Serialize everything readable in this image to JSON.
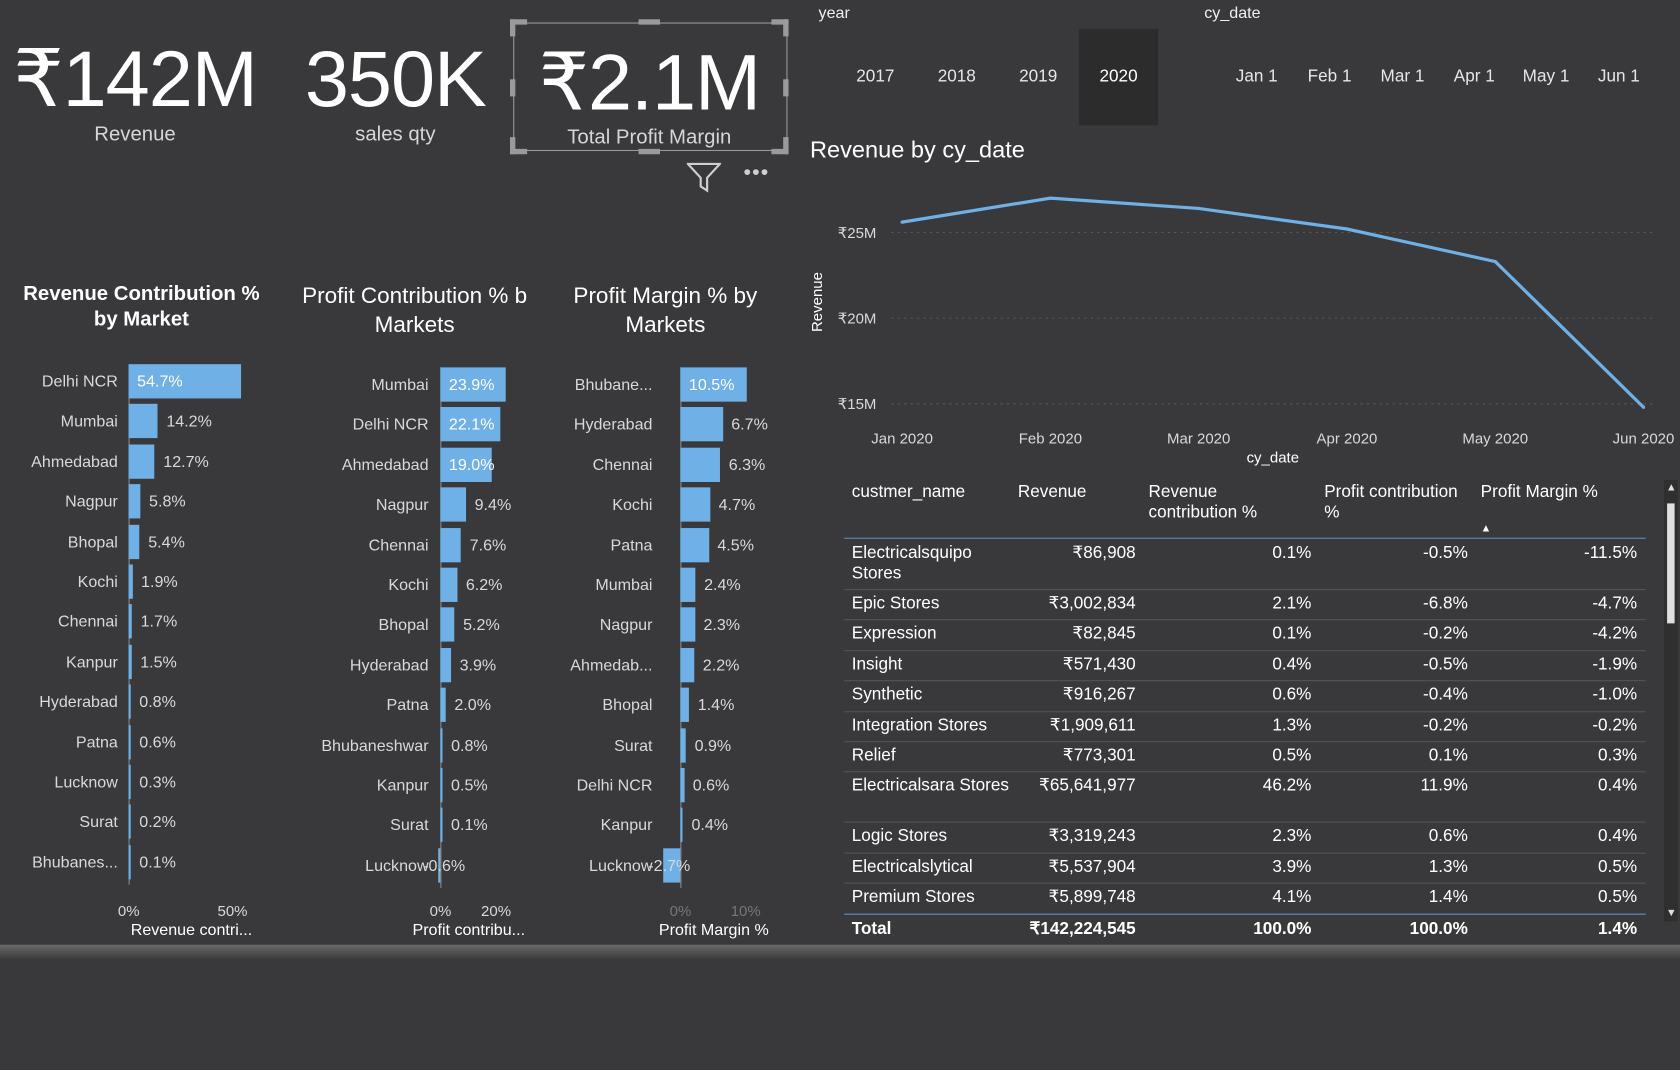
{
  "kpis": [
    {
      "value": "₹142M",
      "label": "Revenue"
    },
    {
      "value": "350K",
      "label": "sales qty"
    },
    {
      "value": "₹2.1M",
      "label": "Total Profit Margin"
    }
  ],
  "header_icons": {
    "filter": "filter-icon",
    "more": "more-options-icon",
    "more_glyph": "•••"
  },
  "year_slicer": {
    "title": "year",
    "items": [
      "2017",
      "2018",
      "2019",
      "2020"
    ],
    "selected": "2020"
  },
  "date_slicer": {
    "title": "cy_date",
    "items": [
      "Jan 1",
      "Feb 1",
      "Mar 1",
      "Apr 1",
      "May 1",
      "Jun 1"
    ]
  },
  "colors": {
    "background": "#39393b",
    "bar": "#6fb0e6",
    "line": "#6fb0e6",
    "selected_slicer": "#2c2c2c"
  },
  "revenue_contribution": {
    "title": "Revenue Contribution % by Market",
    "categories": [
      "Delhi NCR",
      "Mumbai",
      "Ahmedabad",
      "Nagpur",
      "Bhopal",
      "Kochi",
      "Chennai",
      "Kanpur",
      "Hyderabad",
      "Patna",
      "Lucknow",
      "Surat",
      "Bhubanes..."
    ],
    "values": [
      54.7,
      14.2,
      12.7,
      5.8,
      5.4,
      1.9,
      1.7,
      1.5,
      0.8,
      0.6,
      0.3,
      0.2,
      0.1
    ],
    "labels": [
      "54.7%",
      "14.2%",
      "12.7%",
      "5.8%",
      "5.4%",
      "1.9%",
      "1.7%",
      "1.5%",
      "0.8%",
      "0.6%",
      "0.3%",
      "0.2%",
      "0.1%"
    ],
    "ticks": [
      "0%",
      "50%"
    ],
    "xlabel": "Revenue contri..."
  },
  "profit_contribution": {
    "title": "Profit Contribution % b Markets",
    "categories": [
      "Mumbai",
      "Delhi NCR",
      "Ahmedabad",
      "Nagpur",
      "Chennai",
      "Kochi",
      "Bhopal",
      "Hyderabad",
      "Patna",
      "Bhubaneshwar",
      "Kanpur",
      "Surat",
      "Lucknow"
    ],
    "values": [
      23.9,
      22.1,
      19.0,
      9.4,
      7.6,
      6.2,
      5.2,
      3.9,
      2.0,
      0.8,
      0.5,
      0.1,
      -0.6
    ],
    "labels": [
      "23.9%",
      "22.1%",
      "19.0%",
      "9.4%",
      "7.6%",
      "6.2%",
      "5.2%",
      "3.9%",
      "2.0%",
      "0.8%",
      "0.5%",
      "0.1%",
      "-0.6%"
    ],
    "ticks": [
      "0%",
      "20%"
    ],
    "xlabel": "Profit contribu..."
  },
  "profit_margin": {
    "title": "Profit Margin % by Markets",
    "categories": [
      "Bhubane...",
      "Hyderabad",
      "Chennai",
      "Kochi",
      "Patna",
      "Mumbai",
      "Nagpur",
      "Ahmedab...",
      "Bhopal",
      "Surat",
      "Delhi NCR",
      "Kanpur",
      "Lucknow"
    ],
    "values": [
      10.5,
      6.7,
      6.3,
      4.7,
      4.5,
      2.4,
      2.3,
      2.2,
      1.4,
      0.9,
      0.6,
      0.4,
      -2.7
    ],
    "labels": [
      "10.5%",
      "6.7%",
      "6.3%",
      "4.7%",
      "4.5%",
      "2.4%",
      "2.3%",
      "2.2%",
      "1.4%",
      "0.9%",
      "0.6%",
      "0.4%",
      "-2.7%"
    ],
    "ticks": [
      "0%",
      "10%"
    ],
    "xlabel": "Profit Margin %"
  },
  "chart_data": {
    "type": "line",
    "title": "Revenue by cy_date",
    "x": [
      "Jan 2020",
      "Feb 2020",
      "Mar 2020",
      "Apr 2020",
      "May 2020",
      "Jun 2020"
    ],
    "y_ticks": [
      "₹25M",
      "₹20M",
      "₹15M"
    ],
    "ylim": [
      15,
      25
    ],
    "series": [
      {
        "values": [
          25.6,
          27.0,
          26.4,
          25.2,
          23.3,
          14.8
        ]
      }
    ],
    "xlabel": "cy_date",
    "ylabel": "Revenue",
    "grid": true
  },
  "table": {
    "headers": [
      "custmer_name",
      "Revenue",
      "Revenue contribution %",
      "Profit contribution %",
      "Profit Margin %"
    ],
    "sort_indicator": "▲",
    "rows": [
      [
        "Electricalsquipo Stores",
        "₹86,908",
        "0.1%",
        "-0.5%",
        "-11.5%"
      ],
      [
        "Epic Stores",
        "₹3,002,834",
        "2.1%",
        "-6.8%",
        "-4.7%"
      ],
      [
        "Expression",
        "₹82,845",
        "0.1%",
        "-0.2%",
        "-4.2%"
      ],
      [
        "Insight",
        "₹571,430",
        "0.4%",
        "-0.5%",
        "-1.9%"
      ],
      [
        "Synthetic",
        "₹916,267",
        "0.6%",
        "-0.4%",
        "-1.0%"
      ],
      [
        "Integration Stores",
        "₹1,909,611",
        "1.3%",
        "-0.2%",
        "-0.2%"
      ],
      [
        "Relief",
        "₹773,301",
        "0.5%",
        "0.1%",
        "0.3%"
      ],
      [
        "Electricalsara Stores",
        "₹65,641,977",
        "46.2%",
        "11.9%",
        "0.4%"
      ],
      [
        "Logic Stores",
        "₹3,319,243",
        "2.3%",
        "0.6%",
        "0.4%"
      ],
      [
        "Electricalslytical",
        "₹5,537,904",
        "3.9%",
        "1.3%",
        "0.5%"
      ],
      [
        "Premium Stores",
        "₹5,899,748",
        "4.1%",
        "1.4%",
        "0.5%"
      ]
    ],
    "total": [
      "Total",
      "₹142,224,545",
      "100.0%",
      "100.0%",
      "1.4%"
    ]
  }
}
